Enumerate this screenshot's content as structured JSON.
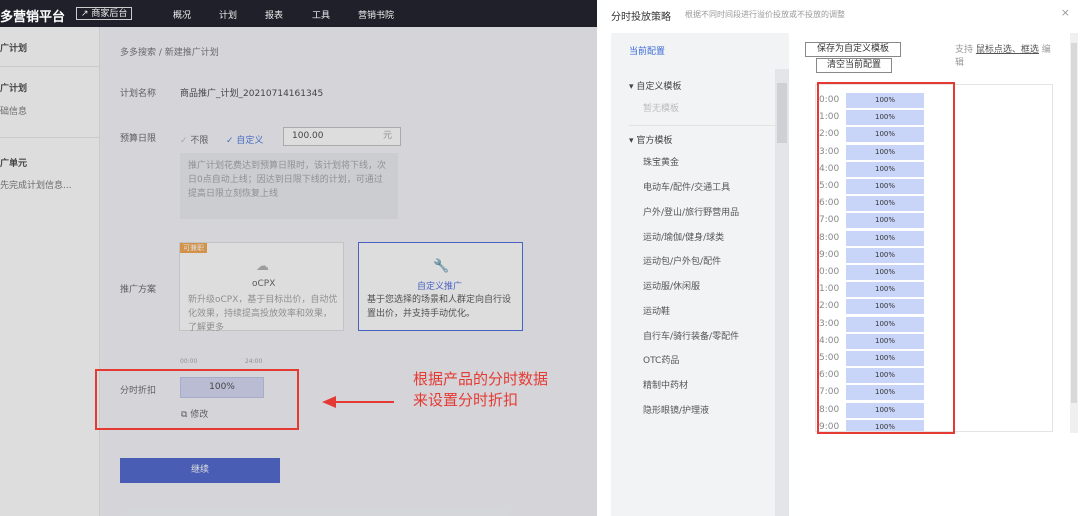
{
  "topbar": {
    "brand": "多营销平台",
    "merchant_link": "↗ 商家后台",
    "nav": [
      "概况",
      "计划",
      "报表",
      "工具",
      "营销书院"
    ]
  },
  "sidebar": {
    "sections": [
      {
        "title": "广计划",
        "sub": "础信息"
      },
      {
        "title": "广计划",
        "sub": ""
      },
      {
        "title": "广单元",
        "sub": "先完成计划信息..."
      }
    ]
  },
  "form": {
    "breadcrumb": "多多搜索 / 新建推广计划",
    "plan_name_label": "计划名称",
    "plan_name_value": "商品推广_计划_20210714161345",
    "budget_label": "预算日限",
    "budget_unlimited": "不限",
    "budget_custom": "自定义",
    "budget_value": "100.00",
    "budget_unit": "元",
    "budget_tip": "推广计划花费达到预算日限时，该计划将下线，次日0点自动上线；因达到日限下线的计划，可通过提高日限立刻恢复上线",
    "method_label": "推广方案",
    "ocpx": {
      "badge": "可兼职",
      "title": "oCPX",
      "desc": "新升级oCPX，基于目标出价，自动优化效果，持续提高投放效率和效果，了解更多"
    },
    "custom": {
      "title": "自定义推广",
      "desc": "基于您选择的场景和人群定向自行设置出价，并支持手动优化。"
    },
    "scale_start": "00:00",
    "scale_end": "24:00",
    "discount_label": "分时折扣",
    "discount_value": "100%",
    "edit_label": "修改",
    "continue_label": "继续"
  },
  "annotation": {
    "line1": "根据产品的分时数据",
    "line2": "来设置分时折扣"
  },
  "panel": {
    "title": "分时投放策略",
    "subtitle": "根据不同时间段进行溢价投放或不投放的调整",
    "close": "×",
    "current_config": "当前配置",
    "custom_group": "自定义模板",
    "custom_empty": "暂无模板",
    "official_group": "官方模板",
    "templates": [
      "珠宝黄金",
      "电动车/配件/交通工具",
      "户外/登山/旅行野营用品",
      "运动/瑜伽/健身/球类",
      "运动包/户外包/配件",
      "运动服/休闲服",
      "运动鞋",
      "自行车/骑行装备/零配件",
      "OTC药品",
      "精制中药材",
      "隐形眼镜/护理液"
    ],
    "save_template": "保存为自定义模板",
    "clear_config": "清空当前配置",
    "hint_prefix": "支持",
    "hint_link": "鼠标点选、框选",
    "hint_suffix": "编辑",
    "hours": [
      "0:00",
      "1:00",
      "2:00",
      "3:00",
      "4:00",
      "5:00",
      "6:00",
      "7:00",
      "8:00",
      "9:00",
      "0:00",
      "1:00",
      "2:00",
      "3:00",
      "4:00",
      "5:00",
      "6:00",
      "7:00",
      "8:00",
      "9:00"
    ],
    "cell_value": "100%"
  },
  "colors": {
    "accent": "#3a55c9",
    "annotation_red": "#e53a34",
    "cell_blue": "#c9d5f8"
  }
}
